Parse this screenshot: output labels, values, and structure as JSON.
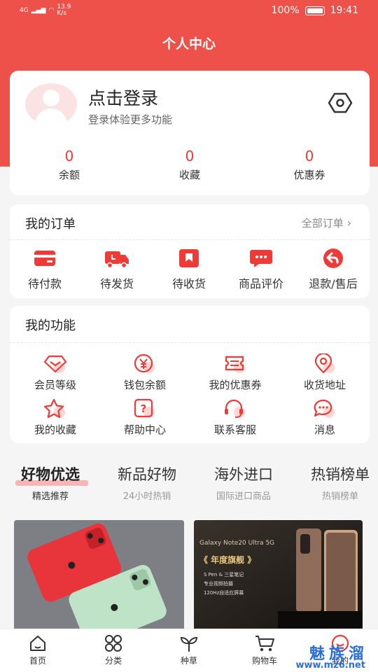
{
  "status_bar": {
    "network": "4G",
    "speed": "13.9 K/s",
    "battery": "100%",
    "time": "19:41"
  },
  "page_title": "个人中心",
  "profile": {
    "login_label": "点击登录",
    "login_sub": "登录体验更多功能",
    "stats": [
      {
        "value": "0",
        "label": "余额"
      },
      {
        "value": "0",
        "label": "收藏"
      },
      {
        "value": "0",
        "label": "优惠券"
      }
    ]
  },
  "orders": {
    "title": "我的订单",
    "all_label": "全部订单",
    "items": [
      {
        "label": "待付款",
        "icon": "wallet-card-icon"
      },
      {
        "label": "待发货",
        "icon": "truck-icon"
      },
      {
        "label": "待收货",
        "icon": "package-icon"
      },
      {
        "label": "商品评价",
        "icon": "chat-bubble-icon"
      },
      {
        "label": "退款/售后",
        "icon": "return-arrow-icon"
      }
    ]
  },
  "functions": {
    "title": "我的功能",
    "items": [
      {
        "label": "会员等级",
        "icon": "diamond-icon"
      },
      {
        "label": "钱包余额",
        "icon": "yen-coin-icon"
      },
      {
        "label": "我的优惠券",
        "icon": "ticket-icon"
      },
      {
        "label": "收货地址",
        "icon": "location-pin-icon"
      },
      {
        "label": "我的收藏",
        "icon": "star-icon"
      },
      {
        "label": "帮助中心",
        "icon": "question-icon"
      },
      {
        "label": "联系客服",
        "icon": "headset-icon"
      },
      {
        "label": "消息",
        "icon": "message-icon"
      }
    ]
  },
  "tabs": [
    {
      "title": "好物优选",
      "sub": "精选推荐",
      "active": true
    },
    {
      "title": "新品好物",
      "sub": "24小时热销"
    },
    {
      "title": "海外进口",
      "sub": "国际进口商品"
    },
    {
      "title": "热销榜单",
      "sub": "热销榜单"
    }
  ],
  "product2": {
    "brand": "Galaxy Note20 Ultra 5G",
    "headline": "《 年度旗舰 》",
    "bullets": [
      "S Pen & 三星笔记",
      "专业视频拍摄",
      "120Hz自适应屏幕"
    ]
  },
  "bottom_nav": [
    {
      "label": "首页",
      "icon": "home-icon"
    },
    {
      "label": "分类",
      "icon": "grid-icon"
    },
    {
      "label": "种草",
      "icon": "sprout-icon"
    },
    {
      "label": "购物车",
      "icon": "cart-icon"
    },
    {
      "label": "我的",
      "icon": "profile-icon"
    }
  ],
  "watermark": {
    "text": "魅族溜",
    "url": "www.mz6.net"
  },
  "colors": {
    "brand_red": "#ee5149",
    "accent_red": "#ee3b37"
  }
}
